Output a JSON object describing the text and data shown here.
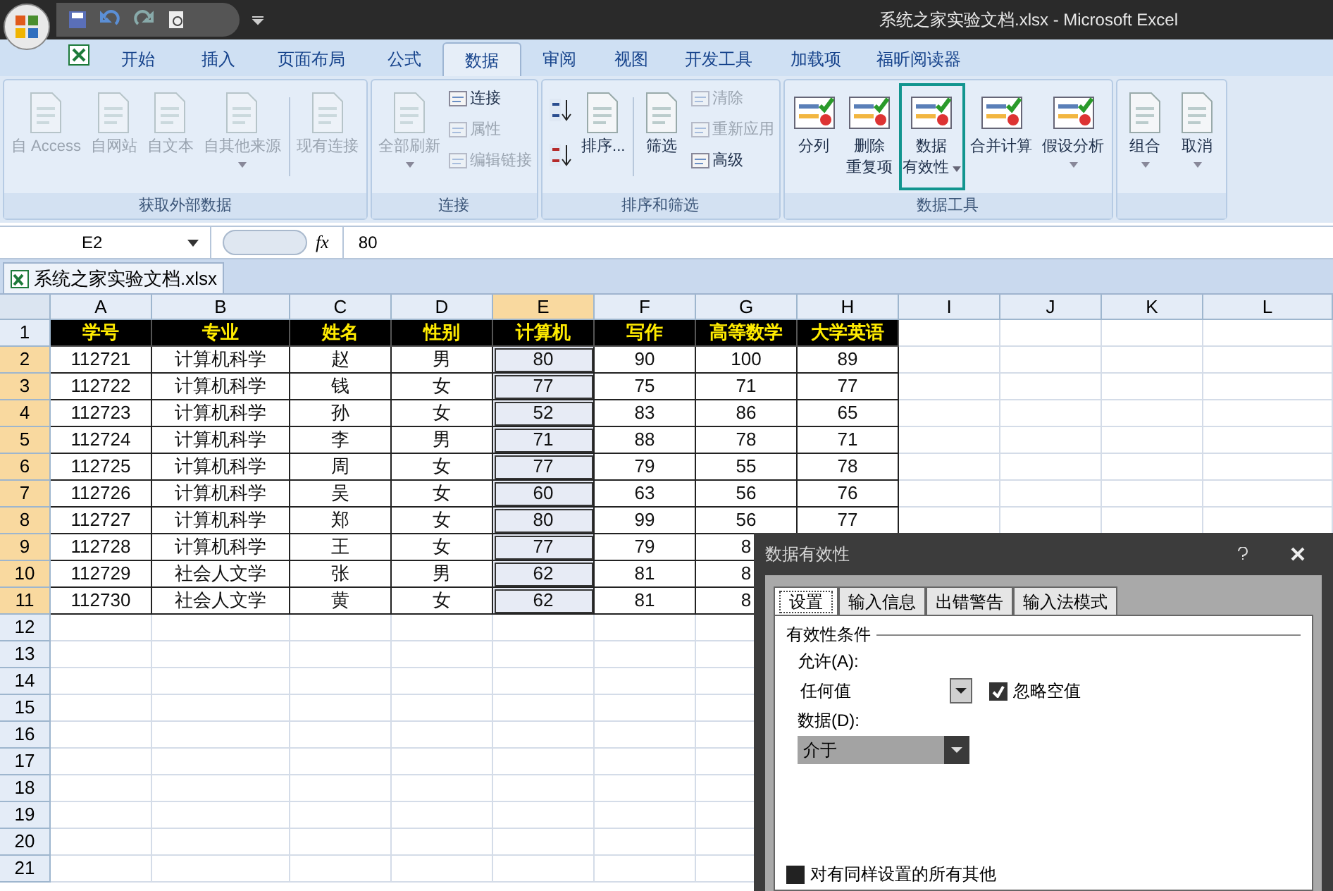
{
  "title_bar": {
    "title": "系统之家实验文档.xlsx - Microsoft Excel"
  },
  "tabs": [
    {
      "label": "开始",
      "selected": false
    },
    {
      "label": "插入",
      "selected": false
    },
    {
      "label": "页面布局",
      "selected": false
    },
    {
      "label": "公式",
      "selected": false
    },
    {
      "label": "数据",
      "selected": true
    },
    {
      "label": "审阅",
      "selected": false
    },
    {
      "label": "视图",
      "selected": false
    },
    {
      "label": "开发工具",
      "selected": false
    },
    {
      "label": "加载项",
      "selected": false
    },
    {
      "label": "福昕阅读器",
      "selected": false
    }
  ],
  "ribbon": {
    "groups": [
      {
        "label": "获取外部数据",
        "items": [
          {
            "kind": "large",
            "lines": [
              "自 Access"
            ],
            "disabled": true,
            "dropdown": false,
            "highlighted": false
          },
          {
            "kind": "large",
            "lines": [
              "自网站"
            ],
            "disabled": true,
            "dropdown": false,
            "highlighted": false
          },
          {
            "kind": "large",
            "lines": [
              "自文本"
            ],
            "disabled": true,
            "dropdown": false,
            "highlighted": false
          },
          {
            "kind": "large",
            "lines": [
              "自其他来源"
            ],
            "disabled": true,
            "dropdown": true,
            "highlighted": false
          },
          {
            "kind": "separator"
          },
          {
            "kind": "large",
            "lines": [
              "现有连接"
            ],
            "disabled": true,
            "dropdown": false,
            "highlighted": false
          }
        ]
      },
      {
        "label": "连接",
        "items": [
          {
            "kind": "large",
            "lines": [
              "全部刷新"
            ],
            "disabled": true,
            "dropdown": true,
            "highlighted": false
          },
          {
            "kind": "stack",
            "items": [
              {
                "label": "连接",
                "disabled": false
              },
              {
                "label": "属性",
                "disabled": true
              },
              {
                "label": "编辑链接",
                "disabled": true
              }
            ]
          }
        ]
      },
      {
        "label": "排序和筛选",
        "items": [
          {
            "kind": "sort_icons"
          },
          {
            "kind": "large",
            "lines": [
              "排序..."
            ],
            "disabled": false,
            "dropdown": false,
            "highlighted": false
          },
          {
            "kind": "separator"
          },
          {
            "kind": "large",
            "lines": [
              "筛选"
            ],
            "disabled": false,
            "dropdown": false,
            "highlighted": false
          },
          {
            "kind": "stack",
            "items": [
              {
                "label": "清除",
                "disabled": true
              },
              {
                "label": "重新应用",
                "disabled": true
              },
              {
                "label": "高级",
                "disabled": false
              }
            ]
          }
        ]
      },
      {
        "label": "数据工具",
        "items": [
          {
            "kind": "large",
            "lines": [
              "分列"
            ],
            "disabled": false,
            "dropdown": false,
            "highlighted": false
          },
          {
            "kind": "large",
            "lines": [
              "删除",
              "重复项"
            ],
            "disabled": false,
            "dropdown": false,
            "highlighted": false
          },
          {
            "kind": "large",
            "lines": [
              "数据",
              "有效性"
            ],
            "disabled": false,
            "dropdown": true,
            "highlighted": true
          },
          {
            "kind": "large",
            "lines": [
              "合并计算"
            ],
            "disabled": false,
            "dropdown": false,
            "highlighted": false
          },
          {
            "kind": "large",
            "lines": [
              "假设分析"
            ],
            "disabled": false,
            "dropdown": true,
            "highlighted": false
          }
        ]
      },
      {
        "items": [
          {
            "kind": "large",
            "lines": [
              "组合"
            ],
            "disabled": false,
            "dropdown": true,
            "highlighted": false
          },
          {
            "kind": "large",
            "lines": [
              "取消"
            ],
            "disabled": false,
            "dropdown": true,
            "highlighted": false
          }
        ]
      }
    ]
  },
  "formula_bar": {
    "name_box": "E2",
    "function_label": "fx",
    "value": "80"
  },
  "workbook_tab": {
    "label": "系统之家实验文档.xlsx"
  },
  "sheet": {
    "columns": [
      {
        "label": "A",
        "selected": false
      },
      {
        "label": "B",
        "selected": false
      },
      {
        "label": "C",
        "selected": false
      },
      {
        "label": "D",
        "selected": false
      },
      {
        "label": "E",
        "selected": true
      },
      {
        "label": "F",
        "selected": false
      },
      {
        "label": "G",
        "selected": false
      },
      {
        "label": "H",
        "selected": false
      },
      {
        "label": "I",
        "selected": false
      },
      {
        "label": "J",
        "selected": false
      },
      {
        "label": "K",
        "selected": false
      },
      {
        "label": "L",
        "selected": false
      }
    ],
    "rows": [
      {
        "number": "1",
        "selected": false,
        "kind": "header",
        "cells": [
          "学号",
          "专业",
          "姓名",
          "性别",
          "计算机",
          "写作",
          "高等数学",
          "大学英语"
        ]
      },
      {
        "number": "2",
        "selected": true,
        "kind": "data",
        "cells": [
          "112721",
          "计算机科学",
          "赵",
          "男",
          "80",
          "90",
          "100",
          "89"
        ]
      },
      {
        "number": "3",
        "selected": true,
        "kind": "data",
        "cells": [
          "112722",
          "计算机科学",
          "钱",
          "女",
          "77",
          "75",
          "71",
          "77"
        ]
      },
      {
        "number": "4",
        "selected": true,
        "kind": "data",
        "cells": [
          "112723",
          "计算机科学",
          "孙",
          "女",
          "52",
          "83",
          "86",
          "65"
        ]
      },
      {
        "number": "5",
        "selected": true,
        "kind": "data",
        "cells": [
          "112724",
          "计算机科学",
          "李",
          "男",
          "71",
          "88",
          "78",
          "71"
        ]
      },
      {
        "number": "6",
        "selected": true,
        "kind": "data",
        "cells": [
          "112725",
          "计算机科学",
          "周",
          "女",
          "77",
          "79",
          "55",
          "78"
        ]
      },
      {
        "number": "7",
        "selected": true,
        "kind": "data",
        "cells": [
          "112726",
          "计算机科学",
          "吴",
          "女",
          "60",
          "63",
          "56",
          "76"
        ]
      },
      {
        "number": "8",
        "selected": true,
        "kind": "data",
        "cells": [
          "112727",
          "计算机科学",
          "郑",
          "女",
          "80",
          "99",
          "56",
          "77"
        ]
      },
      {
        "number": "9",
        "selected": true,
        "kind": "data",
        "cells": [
          "112728",
          "计算机科学",
          "王",
          "女",
          "77",
          "79",
          "8"
        ]
      },
      {
        "number": "10",
        "selected": true,
        "kind": "data",
        "cells": [
          "112729",
          "社会人文学",
          "张",
          "男",
          "62",
          "81",
          "8"
        ]
      },
      {
        "number": "11",
        "selected": true,
        "kind": "data",
        "cells": [
          "112730",
          "社会人文学",
          "黄",
          "女",
          "62",
          "81",
          "8"
        ]
      },
      {
        "number": "12",
        "selected": false,
        "kind": "empty",
        "cells": []
      },
      {
        "number": "13",
        "selected": false,
        "kind": "empty",
        "cells": []
      },
      {
        "number": "14",
        "selected": false,
        "kind": "empty",
        "cells": []
      },
      {
        "number": "15",
        "selected": false,
        "kind": "empty",
        "cells": []
      },
      {
        "number": "16",
        "selected": false,
        "kind": "empty",
        "cells": []
      },
      {
        "number": "17",
        "selected": false,
        "kind": "empty",
        "cells": []
      },
      {
        "number": "18",
        "selected": false,
        "kind": "empty",
        "cells": []
      },
      {
        "number": "19",
        "selected": false,
        "kind": "empty",
        "cells": []
      },
      {
        "number": "20",
        "selected": false,
        "kind": "empty",
        "cells": []
      },
      {
        "number": "21",
        "selected": false,
        "kind": "empty",
        "cells": []
      }
    ]
  },
  "dialog": {
    "title": "数据有效性",
    "tabs": [
      {
        "label": "设置",
        "selected": true
      },
      {
        "label": "输入信息",
        "selected": false
      },
      {
        "label": "出错警告",
        "selected": false
      },
      {
        "label": "输入法模式",
        "selected": false
      }
    ],
    "section": "有效性条件",
    "allow_label": "允许(A):",
    "allow_value": "任何值",
    "ignore_blank": {
      "label": "忽略空值",
      "checked": true
    },
    "data_label": "数据(D):",
    "data_value": "介于",
    "data_disabled": true,
    "apply_all": {
      "label": "对有同样设置的所有其他",
      "checked": false
    }
  }
}
